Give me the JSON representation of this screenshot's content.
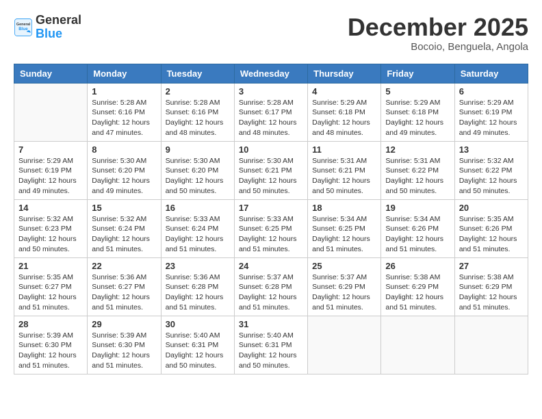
{
  "logo": {
    "general": "General",
    "blue": "Blue"
  },
  "title": "December 2025",
  "location": "Bocoio, Benguela, Angola",
  "days_of_week": [
    "Sunday",
    "Monday",
    "Tuesday",
    "Wednesday",
    "Thursday",
    "Friday",
    "Saturday"
  ],
  "weeks": [
    [
      {
        "day": "",
        "info": ""
      },
      {
        "day": "1",
        "info": "Sunrise: 5:28 AM\nSunset: 6:16 PM\nDaylight: 12 hours\nand 47 minutes."
      },
      {
        "day": "2",
        "info": "Sunrise: 5:28 AM\nSunset: 6:16 PM\nDaylight: 12 hours\nand 48 minutes."
      },
      {
        "day": "3",
        "info": "Sunrise: 5:28 AM\nSunset: 6:17 PM\nDaylight: 12 hours\nand 48 minutes."
      },
      {
        "day": "4",
        "info": "Sunrise: 5:29 AM\nSunset: 6:18 PM\nDaylight: 12 hours\nand 48 minutes."
      },
      {
        "day": "5",
        "info": "Sunrise: 5:29 AM\nSunset: 6:18 PM\nDaylight: 12 hours\nand 49 minutes."
      },
      {
        "day": "6",
        "info": "Sunrise: 5:29 AM\nSunset: 6:19 PM\nDaylight: 12 hours\nand 49 minutes."
      }
    ],
    [
      {
        "day": "7",
        "info": "Sunrise: 5:29 AM\nSunset: 6:19 PM\nDaylight: 12 hours\nand 49 minutes."
      },
      {
        "day": "8",
        "info": "Sunrise: 5:30 AM\nSunset: 6:20 PM\nDaylight: 12 hours\nand 49 minutes."
      },
      {
        "day": "9",
        "info": "Sunrise: 5:30 AM\nSunset: 6:20 PM\nDaylight: 12 hours\nand 50 minutes."
      },
      {
        "day": "10",
        "info": "Sunrise: 5:30 AM\nSunset: 6:21 PM\nDaylight: 12 hours\nand 50 minutes."
      },
      {
        "day": "11",
        "info": "Sunrise: 5:31 AM\nSunset: 6:21 PM\nDaylight: 12 hours\nand 50 minutes."
      },
      {
        "day": "12",
        "info": "Sunrise: 5:31 AM\nSunset: 6:22 PM\nDaylight: 12 hours\nand 50 minutes."
      },
      {
        "day": "13",
        "info": "Sunrise: 5:32 AM\nSunset: 6:22 PM\nDaylight: 12 hours\nand 50 minutes."
      }
    ],
    [
      {
        "day": "14",
        "info": "Sunrise: 5:32 AM\nSunset: 6:23 PM\nDaylight: 12 hours\nand 50 minutes."
      },
      {
        "day": "15",
        "info": "Sunrise: 5:32 AM\nSunset: 6:24 PM\nDaylight: 12 hours\nand 51 minutes."
      },
      {
        "day": "16",
        "info": "Sunrise: 5:33 AM\nSunset: 6:24 PM\nDaylight: 12 hours\nand 51 minutes."
      },
      {
        "day": "17",
        "info": "Sunrise: 5:33 AM\nSunset: 6:25 PM\nDaylight: 12 hours\nand 51 minutes."
      },
      {
        "day": "18",
        "info": "Sunrise: 5:34 AM\nSunset: 6:25 PM\nDaylight: 12 hours\nand 51 minutes."
      },
      {
        "day": "19",
        "info": "Sunrise: 5:34 AM\nSunset: 6:26 PM\nDaylight: 12 hours\nand 51 minutes."
      },
      {
        "day": "20",
        "info": "Sunrise: 5:35 AM\nSunset: 6:26 PM\nDaylight: 12 hours\nand 51 minutes."
      }
    ],
    [
      {
        "day": "21",
        "info": "Sunrise: 5:35 AM\nSunset: 6:27 PM\nDaylight: 12 hours\nand 51 minutes."
      },
      {
        "day": "22",
        "info": "Sunrise: 5:36 AM\nSunset: 6:27 PM\nDaylight: 12 hours\nand 51 minutes."
      },
      {
        "day": "23",
        "info": "Sunrise: 5:36 AM\nSunset: 6:28 PM\nDaylight: 12 hours\nand 51 minutes."
      },
      {
        "day": "24",
        "info": "Sunrise: 5:37 AM\nSunset: 6:28 PM\nDaylight: 12 hours\nand 51 minutes."
      },
      {
        "day": "25",
        "info": "Sunrise: 5:37 AM\nSunset: 6:29 PM\nDaylight: 12 hours\nand 51 minutes."
      },
      {
        "day": "26",
        "info": "Sunrise: 5:38 AM\nSunset: 6:29 PM\nDaylight: 12 hours\nand 51 minutes."
      },
      {
        "day": "27",
        "info": "Sunrise: 5:38 AM\nSunset: 6:29 PM\nDaylight: 12 hours\nand 51 minutes."
      }
    ],
    [
      {
        "day": "28",
        "info": "Sunrise: 5:39 AM\nSunset: 6:30 PM\nDaylight: 12 hours\nand 51 minutes."
      },
      {
        "day": "29",
        "info": "Sunrise: 5:39 AM\nSunset: 6:30 PM\nDaylight: 12 hours\nand 51 minutes."
      },
      {
        "day": "30",
        "info": "Sunrise: 5:40 AM\nSunset: 6:31 PM\nDaylight: 12 hours\nand 50 minutes."
      },
      {
        "day": "31",
        "info": "Sunrise: 5:40 AM\nSunset: 6:31 PM\nDaylight: 12 hours\nand 50 minutes."
      },
      {
        "day": "",
        "info": ""
      },
      {
        "day": "",
        "info": ""
      },
      {
        "day": "",
        "info": ""
      }
    ]
  ]
}
